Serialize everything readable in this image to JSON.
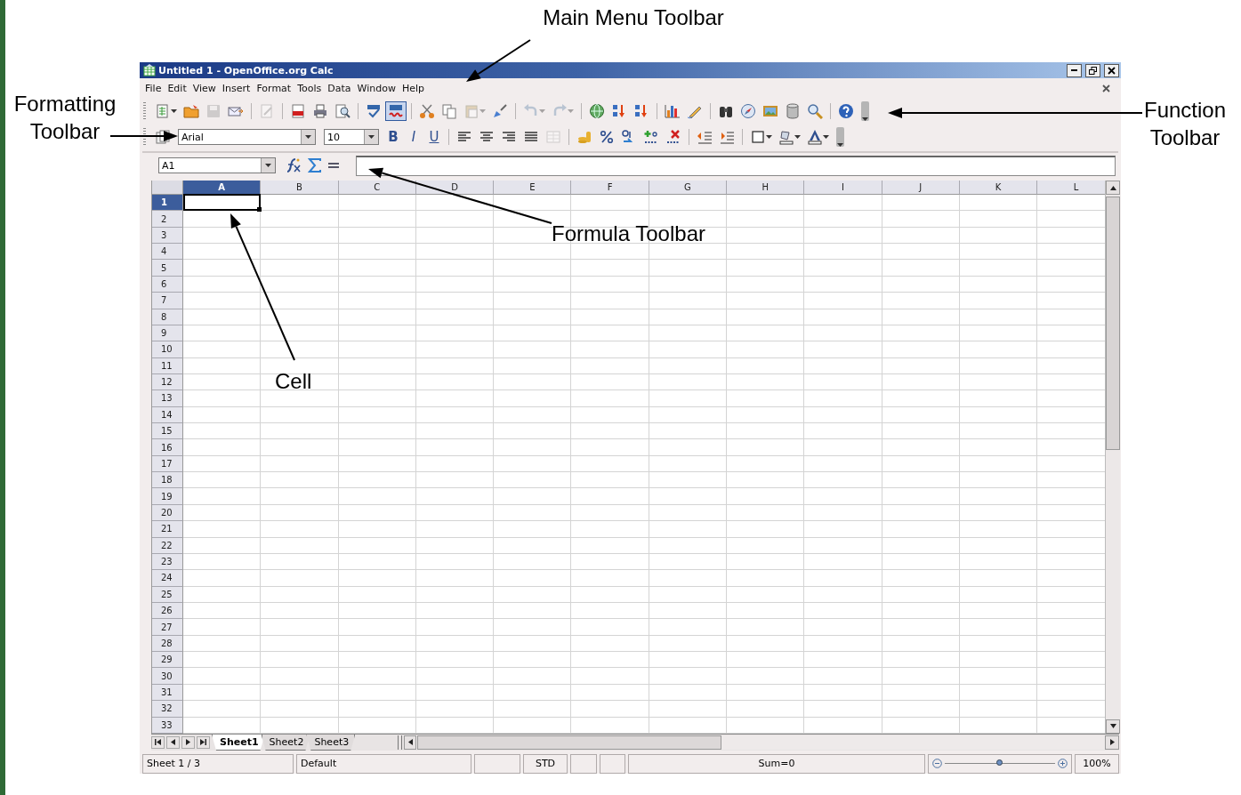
{
  "window": {
    "title": "Untitled 1 - OpenOffice.org Calc"
  },
  "menu": [
    "File",
    "Edit",
    "View",
    "Insert",
    "Format",
    "Tools",
    "Data",
    "Window",
    "Help"
  ],
  "function_toolbar": [
    {
      "kind": "new",
      "disabled": false,
      "dropdown": true,
      "on": false
    },
    {
      "kind": "open",
      "disabled": false,
      "dropdown": false,
      "on": false
    },
    {
      "kind": "save",
      "disabled": true,
      "dropdown": false,
      "on": false
    },
    {
      "kind": "email",
      "disabled": false,
      "dropdown": false,
      "on": false
    },
    {
      "kind": "separator"
    },
    {
      "kind": "edit",
      "disabled": true,
      "dropdown": false,
      "on": false
    },
    {
      "kind": "separator"
    },
    {
      "kind": "pdf",
      "disabled": false,
      "dropdown": false,
      "on": false
    },
    {
      "kind": "print",
      "disabled": false,
      "dropdown": false,
      "on": false
    },
    {
      "kind": "preview",
      "disabled": false,
      "dropdown": false,
      "on": false
    },
    {
      "kind": "separator"
    },
    {
      "kind": "spellcheck",
      "disabled": false,
      "dropdown": false,
      "on": false
    },
    {
      "kind": "autospell",
      "disabled": false,
      "dropdown": false,
      "on": true
    },
    {
      "kind": "separator"
    },
    {
      "kind": "cut",
      "disabled": false,
      "dropdown": false,
      "on": false
    },
    {
      "kind": "copy",
      "disabled": false,
      "dropdown": false,
      "on": false
    },
    {
      "kind": "paste",
      "disabled": true,
      "dropdown": true,
      "on": false
    },
    {
      "kind": "brush",
      "disabled": false,
      "dropdown": false,
      "on": false
    },
    {
      "kind": "separator"
    },
    {
      "kind": "undo",
      "disabled": true,
      "dropdown": true,
      "on": false
    },
    {
      "kind": "redo",
      "disabled": true,
      "dropdown": true,
      "on": false
    },
    {
      "kind": "separator"
    },
    {
      "kind": "hyperlink",
      "disabled": false,
      "dropdown": false,
      "on": false
    },
    {
      "kind": "sort-asc",
      "disabled": false,
      "dropdown": false,
      "on": false
    },
    {
      "kind": "sort-desc",
      "disabled": false,
      "dropdown": false,
      "on": false
    },
    {
      "kind": "separator"
    },
    {
      "kind": "chart",
      "disabled": false,
      "dropdown": false,
      "on": false
    },
    {
      "kind": "draw",
      "disabled": false,
      "dropdown": false,
      "on": false
    },
    {
      "kind": "separator"
    },
    {
      "kind": "find",
      "disabled": false,
      "dropdown": false,
      "on": false
    },
    {
      "kind": "navigator",
      "disabled": false,
      "dropdown": false,
      "on": false
    },
    {
      "kind": "gallery",
      "disabled": false,
      "dropdown": false,
      "on": false
    },
    {
      "kind": "datasources",
      "disabled": false,
      "dropdown": false,
      "on": false
    },
    {
      "kind": "zoom",
      "disabled": false,
      "dropdown": false,
      "on": false
    },
    {
      "kind": "separator"
    },
    {
      "kind": "help",
      "disabled": false,
      "dropdown": false,
      "on": false
    }
  ],
  "formatting_toolbar": [
    {
      "kind": "styles",
      "disabled": false,
      "dropdown": false
    },
    {
      "kind": "font-name",
      "value": "Arial"
    },
    {
      "kind": "font-size",
      "value": "10"
    },
    {
      "kind": "bold",
      "label": "B",
      "disabled": false
    },
    {
      "kind": "italic",
      "label": "I",
      "disabled": false
    },
    {
      "kind": "underline",
      "label": "U",
      "disabled": false
    },
    {
      "kind": "separator"
    },
    {
      "kind": "align-left",
      "disabled": false,
      "dropdown": false
    },
    {
      "kind": "align-center",
      "disabled": false,
      "dropdown": false
    },
    {
      "kind": "align-right",
      "disabled": false,
      "dropdown": false
    },
    {
      "kind": "justify",
      "disabled": false,
      "dropdown": false
    },
    {
      "kind": "merge",
      "disabled": true,
      "dropdown": false
    },
    {
      "kind": "separator"
    },
    {
      "kind": "currency",
      "disabled": false,
      "dropdown": false
    },
    {
      "kind": "percent",
      "disabled": false,
      "dropdown": false
    },
    {
      "kind": "standard",
      "disabled": false,
      "dropdown": false
    },
    {
      "kind": "add-decimal",
      "disabled": false,
      "dropdown": false
    },
    {
      "kind": "delete-decimal",
      "disabled": false,
      "dropdown": false
    },
    {
      "kind": "separator"
    },
    {
      "kind": "indent-less",
      "disabled": false,
      "dropdown": false
    },
    {
      "kind": "indent-more",
      "disabled": false,
      "dropdown": false
    },
    {
      "kind": "separator"
    },
    {
      "kind": "borders",
      "disabled": false,
      "dropdown": true
    },
    {
      "kind": "background",
      "disabled": false,
      "dropdown": true
    },
    {
      "kind": "font-color",
      "disabled": false,
      "dropdown": true
    }
  ],
  "formula_bar": {
    "name_box": "A1"
  },
  "columns": [
    {
      "label": "A",
      "selected": true
    },
    {
      "label": "B",
      "selected": false
    },
    {
      "label": "C",
      "selected": false
    },
    {
      "label": "D",
      "selected": false
    },
    {
      "label": "E",
      "selected": false
    },
    {
      "label": "F",
      "selected": false
    },
    {
      "label": "G",
      "selected": false
    },
    {
      "label": "H",
      "selected": false
    },
    {
      "label": "I",
      "selected": false
    },
    {
      "label": "J",
      "selected": false
    },
    {
      "label": "K",
      "selected": false
    },
    {
      "label": "L",
      "selected": false
    }
  ],
  "rows": [
    {
      "label": "1",
      "selected": true
    },
    {
      "label": "2",
      "selected": false
    },
    {
      "label": "3",
      "selected": false
    },
    {
      "label": "4",
      "selected": false
    },
    {
      "label": "5",
      "selected": false
    },
    {
      "label": "6",
      "selected": false
    },
    {
      "label": "7",
      "selected": false
    },
    {
      "label": "8",
      "selected": false
    },
    {
      "label": "9",
      "selected": false
    },
    {
      "label": "10",
      "selected": false
    },
    {
      "label": "11",
      "selected": false
    },
    {
      "label": "12",
      "selected": false
    },
    {
      "label": "13",
      "selected": false
    },
    {
      "label": "14",
      "selected": false
    },
    {
      "label": "15",
      "selected": false
    },
    {
      "label": "16",
      "selected": false
    },
    {
      "label": "17",
      "selected": false
    },
    {
      "label": "18",
      "selected": false
    },
    {
      "label": "19",
      "selected": false
    },
    {
      "label": "20",
      "selected": false
    },
    {
      "label": "21",
      "selected": false
    },
    {
      "label": "22",
      "selected": false
    },
    {
      "label": "23",
      "selected": false
    },
    {
      "label": "24",
      "selected": false
    },
    {
      "label": "25",
      "selected": false
    },
    {
      "label": "26",
      "selected": false
    },
    {
      "label": "27",
      "selected": false
    },
    {
      "label": "28",
      "selected": false
    },
    {
      "label": "29",
      "selected": false
    },
    {
      "label": "30",
      "selected": false
    },
    {
      "label": "31",
      "selected": false
    },
    {
      "label": "32",
      "selected": false
    },
    {
      "label": "33",
      "selected": false
    }
  ],
  "sheet_tabs": [
    {
      "label": "Sheet1",
      "selected": true
    },
    {
      "label": "Sheet2",
      "selected": false
    },
    {
      "label": "Sheet3",
      "selected": false
    }
  ],
  "status_bar": {
    "sheet": "Sheet 1 / 3",
    "page_style": "Default",
    "mode": "STD",
    "sum": "Sum=0",
    "zoom": "100%",
    "zoom_slider": {
      "level": 0.5
    }
  },
  "annotations": [
    {
      "text": "Main Menu Toolbar"
    },
    {
      "text": "Formatting Toolbar"
    },
    {
      "text": "Function Toolbar"
    },
    {
      "text": "Formula Toolbar"
    },
    {
      "text": "Cell"
    }
  ]
}
